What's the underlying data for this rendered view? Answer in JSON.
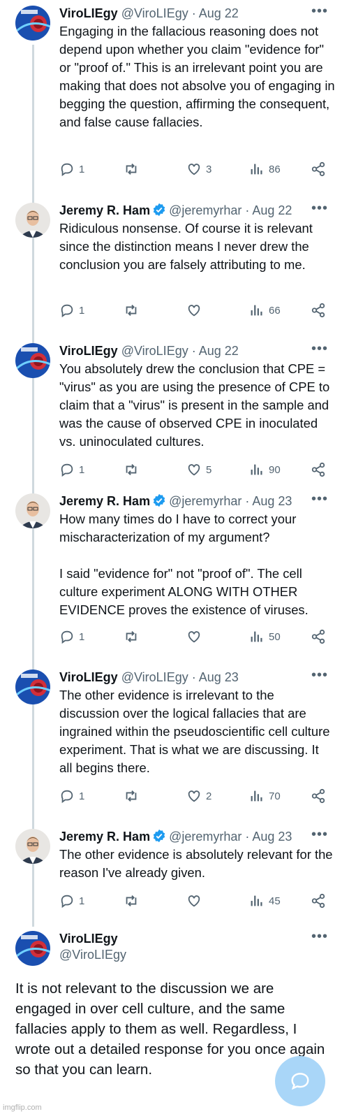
{
  "tweets": [
    {
      "name": "ViroLIEgy",
      "handle": "@ViroLIEgy",
      "date": "· Aug 22",
      "text": "Engaging in the fallacious reasoning does not depend upon whether you claim \"evidence for\" or \"proof of.\" This is an irrelevant point you are making that does not absolve you of engaging in begging the question, affirming the consequent, and false cause fallacies.",
      "replies": "1",
      "likes": "3",
      "views": "86"
    },
    {
      "name": "Jeremy R. Ham",
      "handle": "@jeremyrhar",
      "date": "· Aug 22",
      "text": "Ridiculous nonsense. Of course it is relevant since the distinction means I never drew the conclusion you are falsely attributing to me.",
      "replies": "1",
      "likes": "",
      "views": "66"
    },
    {
      "name": "ViroLIEgy",
      "handle": "@ViroLIEgy",
      "date": "· Aug 22",
      "text": "You absolutely drew the conclusion that CPE = \"virus\" as you are using the presence of CPE to claim that a \"virus\" is present in the sample and was the cause of observed CPE in inoculated vs. uninoculated cultures.",
      "replies": "1",
      "likes": "5",
      "views": "90"
    },
    {
      "name": "Jeremy R. Ham",
      "handle": "@jeremyrhar",
      "date": "· Aug 23",
      "text": "How many times do I have to correct your mischaracterization of my argument?\n\nI said \"evidence for\" not \"proof of\". The cell culture experiment ALONG WITH OTHER EVIDENCE proves the existence of viruses.",
      "replies": "1",
      "likes": "",
      "views": "50"
    },
    {
      "name": "ViroLIEgy",
      "handle": "@ViroLIEgy",
      "date": "· Aug 23",
      "text": "The other evidence is irrelevant to the discussion over the logical fallacies that are ingrained within the pseudoscientific cell culture experiment. That is what we are discussing. It all begins there.",
      "replies": "1",
      "likes": "2",
      "views": "70"
    },
    {
      "name": "Jeremy R. Ham",
      "handle": "@jeremyrhar",
      "date": "· Aug 23",
      "text": "The other evidence is absolutely relevant for the reason I've already given.",
      "replies": "1",
      "likes": "",
      "views": "45"
    }
  ],
  "main_tweet": {
    "name": "ViroLIEgy",
    "handle": "@ViroLIEgy",
    "text": "It is not relevant to the discussion we are engaged in over cell culture, and the same fallacies apply to them as well. Regardless, I wrote out a detailed response for you once again so that you can learn."
  },
  "more_glyph": "•••",
  "watermark": "imgflip.com",
  "colors": {
    "verified": "#1d9bf0",
    "muted": "#536471",
    "line": "#cfd9de"
  }
}
